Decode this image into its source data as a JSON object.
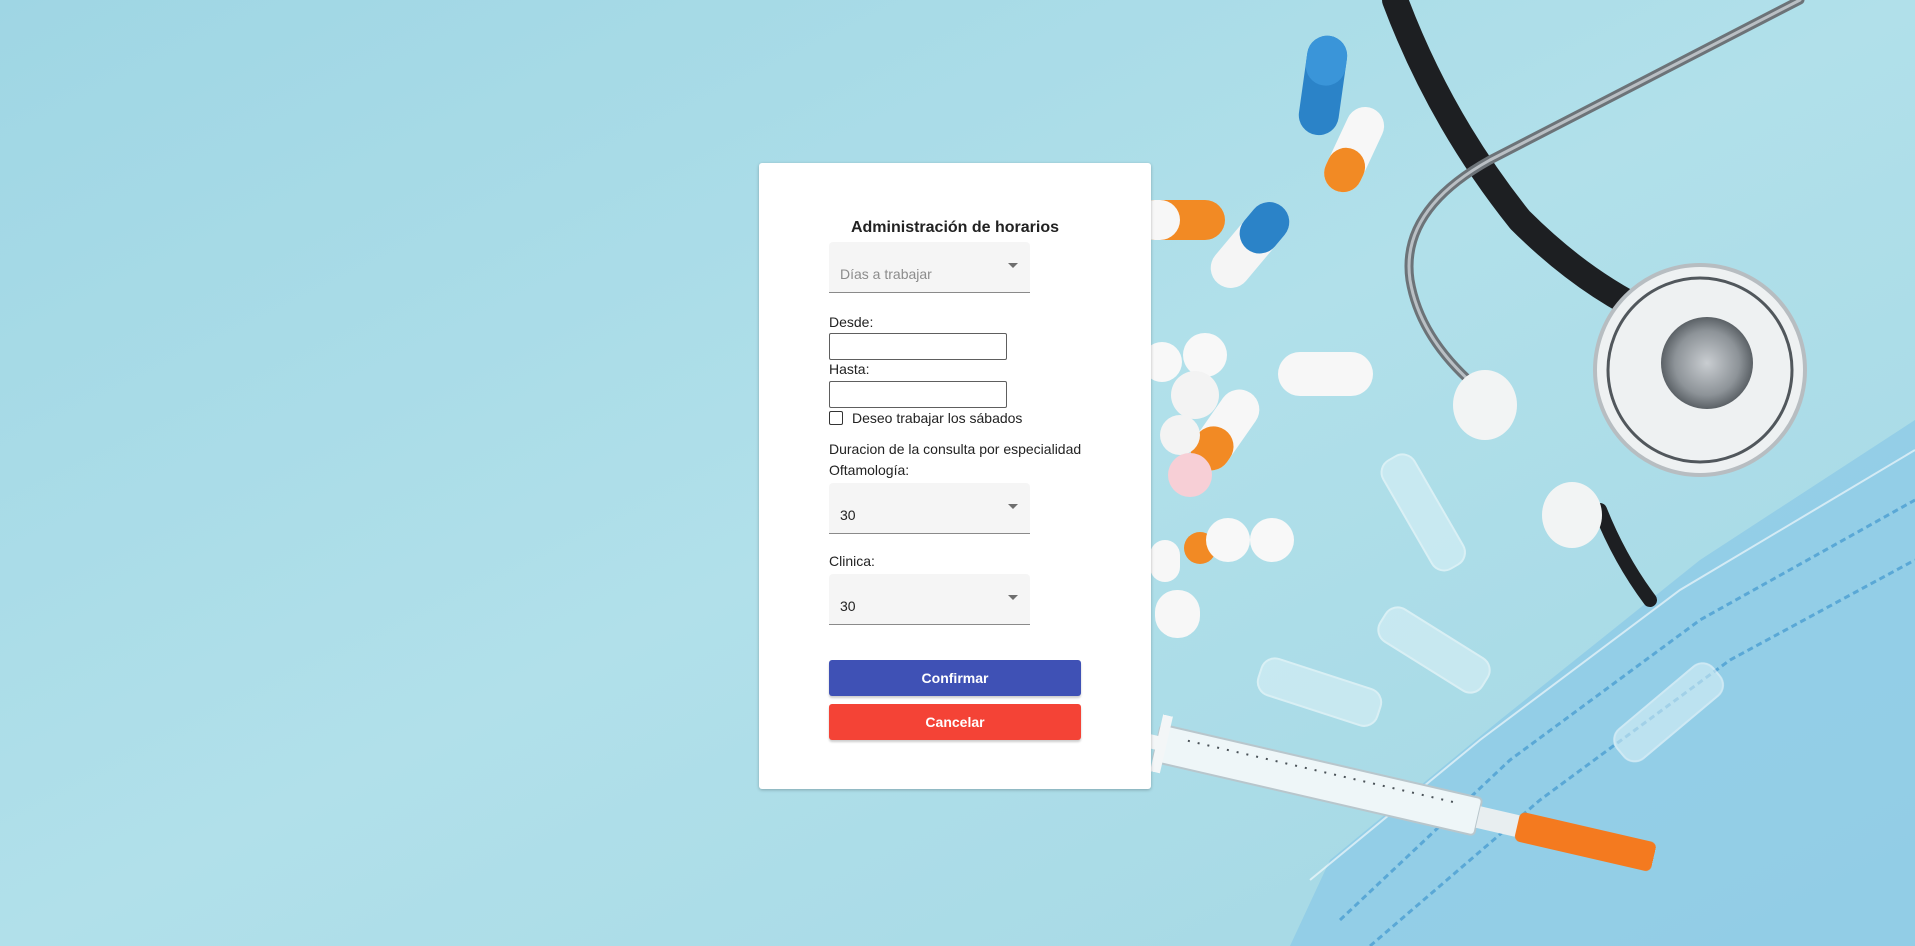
{
  "form": {
    "title": "Administración de horarios",
    "days_select": {
      "placeholder": "Días a trabajar"
    },
    "desde_label": "Desde:",
    "desde_value": "",
    "hasta_label": "Hasta:",
    "hasta_value": "",
    "saturday_checkbox": {
      "label": "Deseo trabajar los sábados",
      "checked": false
    },
    "duration_heading": "Duracion de la consulta por especialidad",
    "oftamologia": {
      "label": "Oftamología:",
      "value": "30"
    },
    "clinica": {
      "label": "Clinica:",
      "value": "30"
    },
    "confirm_label": "Confirmar",
    "cancel_label": "Cancelar"
  },
  "colors": {
    "background": "#a9dbe7",
    "primary": "#3f51b5",
    "warn": "#f44336"
  }
}
